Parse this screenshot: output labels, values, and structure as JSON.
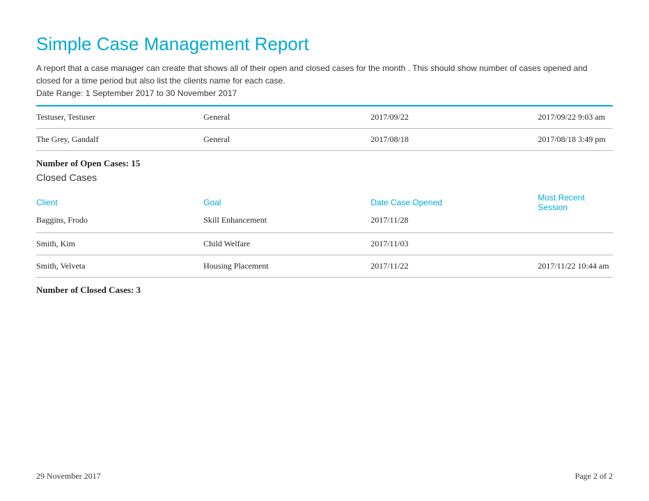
{
  "title": "Simple Case Management Report",
  "description": "A report that a case manager can create that shows all of their open and closed cases for the month . This should show number of cases opened and closed for a time period but also list the clients name for each case.",
  "dateRange": "Date Range: 1 September 2017 to 30 November 2017",
  "openCases": [
    {
      "client": "Testuser, Testuser",
      "goal": "General",
      "opened": "2017/09/22",
      "session": "2017/09/22  9:03 am"
    },
    {
      "client": "The Grey, Gandalf",
      "goal": "General",
      "opened": "2017/08/18",
      "session": "2017/08/18  3:49 pm"
    }
  ],
  "openSummary": "Number of Open Cases: 15",
  "closedHeading": "Closed Cases",
  "headers": {
    "client": "Client",
    "goal": "Goal",
    "opened": "Date Case Opened",
    "session": "Most Recent Session"
  },
  "closedCases": [
    {
      "client": "Baggins, Frodo",
      "goal": "Skill Enhancement",
      "opened": "2017/11/28",
      "session": ""
    },
    {
      "client": "Smith, Kim",
      "goal": "Child Welfare",
      "opened": "2017/11/03",
      "session": ""
    },
    {
      "client": "Smith, Velveta",
      "goal": "Housing Placement",
      "opened": "2017/11/22",
      "session": "2017/11/22  10:44 am"
    }
  ],
  "closedSummary": "Number of Closed Cases: 3",
  "footer": {
    "date": "29 November 2017",
    "page": "Page 2 of 2"
  }
}
